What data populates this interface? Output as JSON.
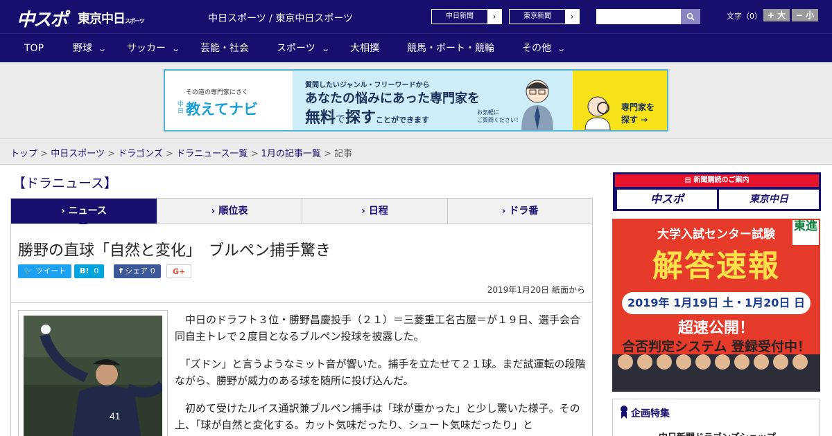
{
  "header": {
    "logo_chuspo": "中スポ",
    "logo_tokyo": "東京中日",
    "logo_tokyo_sub": "スポーツ",
    "site_name": "中日スポーツ / 東京中日スポーツ",
    "ext_links": [
      "中日新聞",
      "東京新聞"
    ],
    "search_placeholder": "",
    "font_label": "文字（0）",
    "font_bigger": "+ 大",
    "font_smaller": "− 小"
  },
  "nav": {
    "items": [
      "TOP",
      "野球",
      "サッカー",
      "芸能・社会",
      "スポーツ",
      "大相撲",
      "競馬・ボート・競輪",
      "その他"
    ]
  },
  "banner": {
    "left_small": "その道の専門家にきく",
    "left_brand": "教えてナビ",
    "left_mini": "中日",
    "line1": "質問したいジャンル・フリーワードから",
    "line2": "あなたの悩みにあった専門家を",
    "line3_a": "無料",
    "line3_b": "で",
    "line3_c": "探す",
    "line3_d": "ことができます",
    "note": "お気軽に\nご質問ください！",
    "right": "専門家を\n探す →"
  },
  "breadcrumb": {
    "links": [
      "トップ",
      "中日スポーツ",
      "ドラゴンズ",
      "ドラニュース一覧",
      "1月の記事一覧"
    ],
    "current": "記事",
    "separator": ">"
  },
  "section_title": "【ドラニュース】",
  "tabs": [
    "ニュース",
    "順位表",
    "日程",
    "ドラ番"
  ],
  "article": {
    "headline": "勝野の直球「自然と変化」　ブルペン捕手驚き",
    "share": {
      "tweet": "ツイート",
      "hatena_label": "B!",
      "hatena_count": "0",
      "facebook": "シェア",
      "facebook_count": "0",
      "gplus": "G+"
    },
    "date": "2019年1月20日 紙面から",
    "paragraphs": [
      "中日のドラフト３位・勝野昌慶投手（２１）＝三菱重工名古屋＝が１９日、選手会合同自主トレで２度目となるブルペン投球を披露した。",
      "「ズドン」と言うようなミット音が響いた。捕手を立たせて２１球。まだ試運転の段階ながら、勝野が威力のある球を随所に投げ込んだ。",
      "初めて受けたルイス通訳兼ブルペン捕手は「球が重かった」と少し驚いた様子。その上、「球が自然と変化する。カット気味だったり、シュート気味だったり」と"
    ]
  },
  "sidebar": {
    "subscribe_title": "新聞購読のご案内",
    "subscribe_logos": [
      "中スポ",
      "東京中日"
    ],
    "ad": {
      "title": "大学入試センター試験",
      "big": "解答速報",
      "date": "2019年 1月19日 土・1月20日 日",
      "fast": "超速公開！",
      "system": "合否判定システム 登録受付中！",
      "badge": "東進"
    },
    "feature_title": "企画特集",
    "feature_item": "中日新聞ドラゴンズショップ"
  }
}
